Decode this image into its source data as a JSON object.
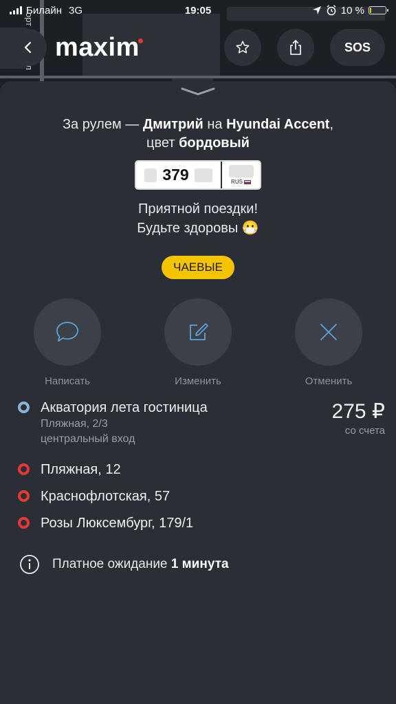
{
  "status_bar": {
    "carrier": "Билайн",
    "network": "3G",
    "time": "19:05",
    "battery": "10 %",
    "battery_level": 0.1
  },
  "map": {
    "street_label": "орт проезд ал"
  },
  "header": {
    "logo": "maxim",
    "sos_label": "SOS"
  },
  "trip": {
    "driver_prefix": "За рулем — ",
    "driver_name": "Дмитрий",
    "car_prefix": " на ",
    "car_model": "Hyundai Accent",
    "car_suffix": ",",
    "color_prefix": "цвет ",
    "color": "бордовый",
    "plate_number": "379",
    "plate_country": "RUS",
    "wish_line1": "Приятной поездки!",
    "wish_line2": "Будьте здоровы",
    "wish_emoji": "😷",
    "tips_label": "ЧАЕВЫЕ"
  },
  "actions": [
    {
      "label": "Написать",
      "icon": "chat-bubble-icon"
    },
    {
      "label": "Изменить",
      "icon": "edit-icon"
    },
    {
      "label": "Отменить",
      "icon": "close-icon"
    }
  ],
  "route": {
    "start": {
      "title": "Акватория лета гостиница",
      "address": "Пляжная, 2/3",
      "note": "центральный вход"
    },
    "stops": [
      "Пляжная, 12",
      "Краснофлотская, 57",
      "Розы Люксембург, 179/1"
    ]
  },
  "price": {
    "amount": "275 ₽",
    "note": "со счета"
  },
  "waiting": {
    "text": "Платное ожидание ",
    "value": "1 минута"
  },
  "colors": {
    "background": "#2b2e35",
    "accent_yellow": "#f5c400",
    "stop_red": "#e53935",
    "start_blue": "#8ab4d6"
  }
}
